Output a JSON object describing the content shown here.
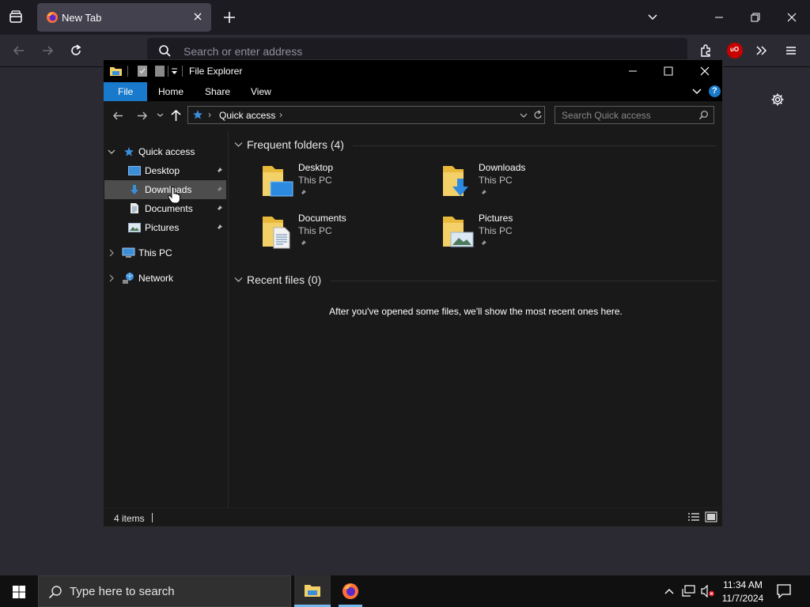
{
  "browser": {
    "tab_title": "New Tab",
    "url_placeholder": "Search or enter address",
    "extension_badge": "uO"
  },
  "explorer": {
    "title": "File Explorer",
    "ribbon_tabs": [
      "File",
      "Home",
      "Share",
      "View"
    ],
    "address_path": "Quick access",
    "search_placeholder": "Search Quick access",
    "nav": {
      "quick_access": "Quick access",
      "pinned": [
        "Desktop",
        "Downloads",
        "Documents",
        "Pictures"
      ],
      "selected": "Downloads",
      "this_pc": "This PC",
      "network": "Network"
    },
    "frequent_header": "Frequent folders (4)",
    "folders": [
      {
        "name": "Desktop",
        "location": "This PC"
      },
      {
        "name": "Downloads",
        "location": "This PC"
      },
      {
        "name": "Documents",
        "location": "This PC"
      },
      {
        "name": "Pictures",
        "location": "This PC"
      }
    ],
    "recent_header": "Recent files (0)",
    "recent_empty": "After you've opened some files, we'll show the most recent ones here.",
    "status_items": "4 items"
  },
  "taskbar": {
    "search_placeholder": "Type here to search",
    "time": "11:34 AM",
    "date": "11/7/2024"
  },
  "colors": {
    "accent": "#1979ca",
    "folder": "#f4d069",
    "firefox_orange": "#ff7139"
  }
}
